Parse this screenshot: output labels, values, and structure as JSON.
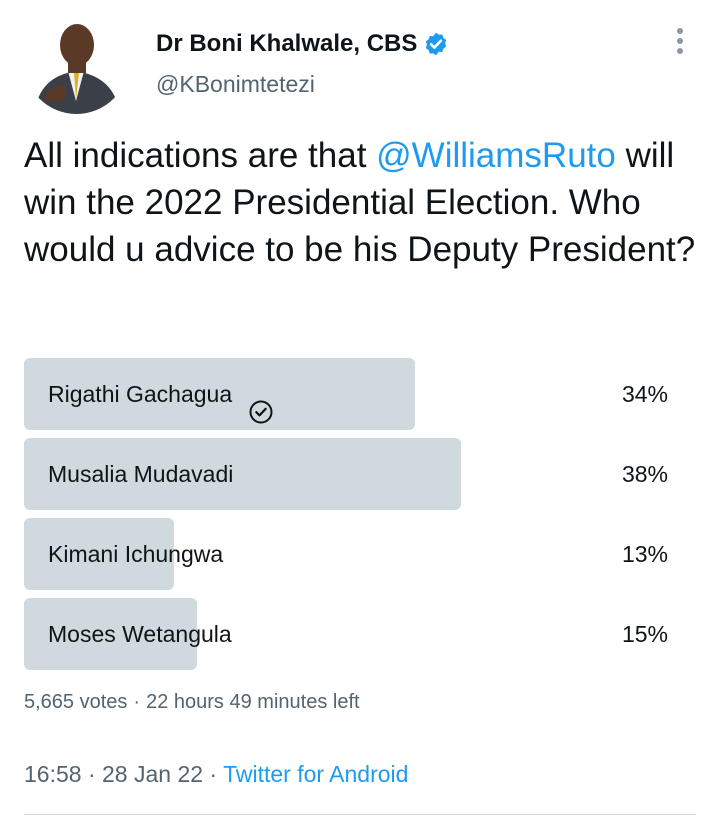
{
  "author": {
    "display_name": "Dr Boni Khalwale, CBS",
    "handle": "@KBonimtetezi",
    "verified": true
  },
  "tweet": {
    "text_before_mention": "All indications are that ",
    "mention": "@WilliamsRuto",
    "text_after_mention": " will win the 2022 Presidential Election. Who would u advice to be his Deputy President?"
  },
  "poll": {
    "options": [
      {
        "label": "Rigathi Gachagua",
        "percent_label": "34%",
        "percent": 34,
        "winner_check": true
      },
      {
        "label": "Musalia Mudavadi",
        "percent_label": "38%",
        "percent": 38,
        "winner_check": false
      },
      {
        "label": "Kimani Ichungwa",
        "percent_label": "13%",
        "percent": 13,
        "winner_check": false
      },
      {
        "label": "Moses Wetangula",
        "percent_label": "15%",
        "percent": 15,
        "winner_check": false
      }
    ],
    "votes": "5,665 votes",
    "separator": "·",
    "time_left": "22 hours 49 minutes left"
  },
  "meta": {
    "time": "16:58",
    "sep1": " · ",
    "date": "28 Jan 22",
    "sep2": " · ",
    "source": "Twitter for Android"
  },
  "colors": {
    "accent": "#1d9bf0",
    "bar": "#cfd9de",
    "text": "#0f1419",
    "muted": "#536471"
  },
  "icons": {
    "verified": "verified-badge-icon",
    "more": "more-vertical-icon",
    "check": "check-circle-icon"
  }
}
